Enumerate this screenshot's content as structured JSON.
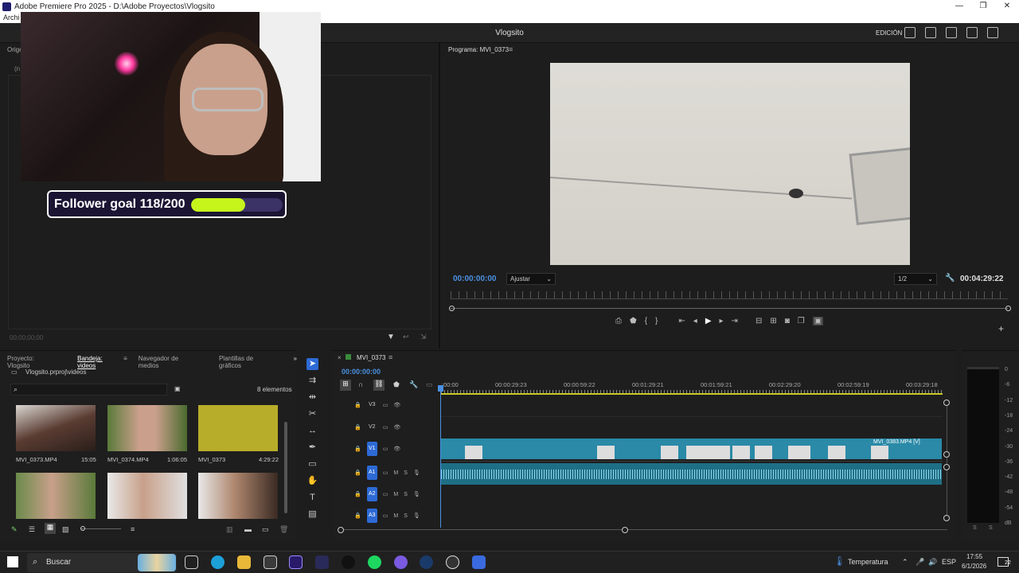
{
  "window": {
    "title": "Adobe Premiere Pro 2025 - D:\\Adobe Proyectos\\Vlogsito",
    "menu_first": "Archi"
  },
  "header": {
    "project_title": "Vlogsito",
    "workspace": "EDICIÓN"
  },
  "source_panel": {
    "label": "Orige",
    "sub": "(n",
    "timecode": "00;00;00;00"
  },
  "overlay": {
    "goal_text": "Follower goal 118/200",
    "goal_progress": 0.59,
    "goal_fill_color": "#c6f51c"
  },
  "program": {
    "label": "Programa: MVI_0373",
    "timecode_in": "00:00:00:00",
    "fit": "Ajustar",
    "resolution": "1/2",
    "duration": "00:04:29:22"
  },
  "project": {
    "tabs": [
      "Proyecto: Vlogsito",
      "Bandeja: videos",
      "Navegador de medios",
      "Plantillas de gráficos"
    ],
    "path": "Vlogsito.prproj\\videos",
    "count": "8 elementos",
    "items": [
      {
        "name": "MVI_0373.MP4",
        "duration": "15:05"
      },
      {
        "name": "MVI_0374.MP4",
        "duration": "1:06:05"
      },
      {
        "name": "MVI_0373",
        "duration": "4:29:22"
      }
    ]
  },
  "timeline": {
    "tab": "MVI_0373",
    "timecode": "00:00:00:00",
    "ruler": [
      ":00:00",
      "00:00:29:23",
      "00:00:59:22",
      "00:01:29:21",
      "00:01:59:21",
      "00:02:29:20",
      "00:02:59:19",
      "00:03:29:18"
    ],
    "tracks": [
      "V3",
      "V2",
      "V1",
      "A1",
      "A2",
      "A3"
    ],
    "clip_label": "MVI_0383.MP4 [V]"
  },
  "meters": {
    "scale": [
      "0",
      "-6",
      "-12",
      "-18",
      "-24",
      "-30",
      "-36",
      "-42",
      "-48",
      "-54",
      "dB"
    ],
    "solo": [
      "S",
      "S"
    ]
  },
  "taskbar": {
    "search": "Buscar",
    "weather": "Temperatura",
    "lang": "ESP",
    "time": "17:55",
    "date": "6/1/2026",
    "notif": "22"
  }
}
